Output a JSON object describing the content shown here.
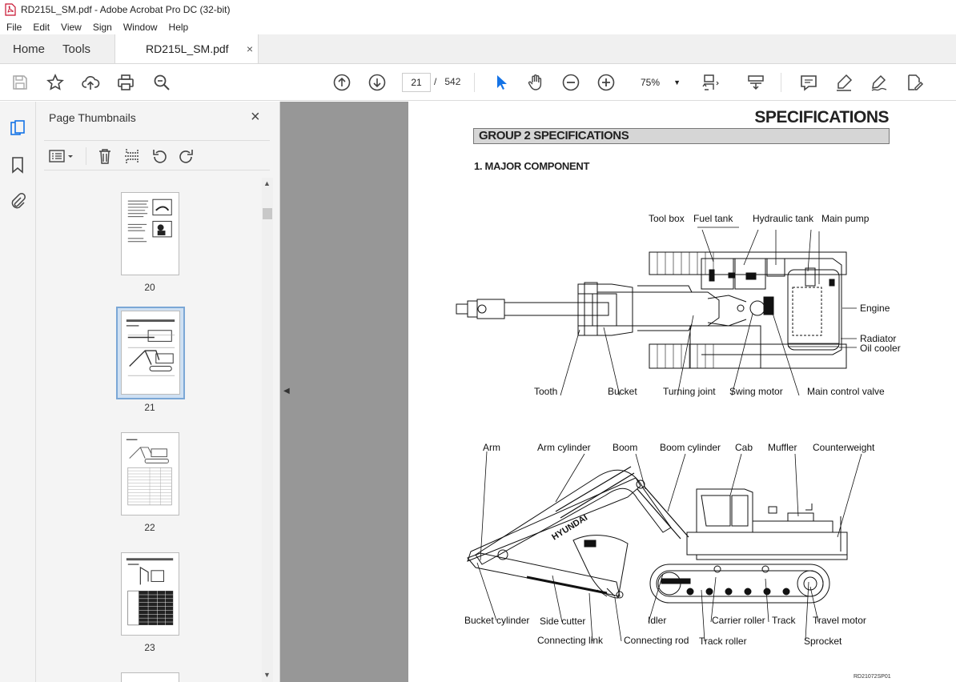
{
  "window": {
    "title": "RD215L_SM.pdf - Adobe Acrobat Pro DC (32-bit)"
  },
  "menu": [
    "File",
    "Edit",
    "View",
    "Sign",
    "Window",
    "Help"
  ],
  "tabs": {
    "home": "Home",
    "tools": "Tools",
    "document": "RD215L_SM.pdf",
    "close": "×"
  },
  "toolbar": {
    "current_page": "21",
    "separator": "/",
    "total_pages": "542",
    "zoom": "75%",
    "icons": [
      "save-icon",
      "bookmark-star-icon",
      "upload-icon",
      "print-icon",
      "search-zoom-icon",
      "prev-page-icon",
      "next-page-icon",
      "select-cursor-icon",
      "hand-icon",
      "zoom-out-icon",
      "zoom-in-icon",
      "fit-page-icon",
      "scroll-mode-icon",
      "comment-icon",
      "highlight-icon",
      "sign-icon",
      "edit-pdf-icon"
    ]
  },
  "sidebar": {
    "title": "Page Thumbnails",
    "close": "×",
    "thumbnails": [
      {
        "page": "20",
        "selected": false
      },
      {
        "page": "21",
        "selected": true
      },
      {
        "page": "22",
        "selected": false
      },
      {
        "page": "23",
        "selected": false
      }
    ]
  },
  "document": {
    "title": "SPECIFICATIONS",
    "group": "GROUP 2 SPECIFICATIONS",
    "section": "1. MAJOR COMPONENT",
    "top_labels": [
      "Tool box",
      "Fuel tank",
      "Hydraulic tank",
      "Main pump",
      "Engine",
      "Radiator",
      "Oil cooler",
      "Tooth",
      "Bucket",
      "Turning joint",
      "Swing motor",
      "Main control valve"
    ],
    "side_labels": [
      "Arm",
      "Arm cylinder",
      "Boom",
      "Boom cylinder",
      "Cab",
      "Muffler",
      "Counterweight",
      "Bucket cylinder",
      "Side cutter",
      "Connecting link",
      "Connecting rod",
      "Idler",
      "Carrier roller",
      "Track roller",
      "Track",
      "Sprocket",
      "Travel motor"
    ],
    "boom_text": "HYUNDAI",
    "figure_code": "RD21072SP01"
  },
  "colors": {
    "doc_bg": "#979797",
    "selected_thumb": "#cfe0f2",
    "accent_blue": "#1473e6",
    "group_bar": "#d6d6d6"
  }
}
